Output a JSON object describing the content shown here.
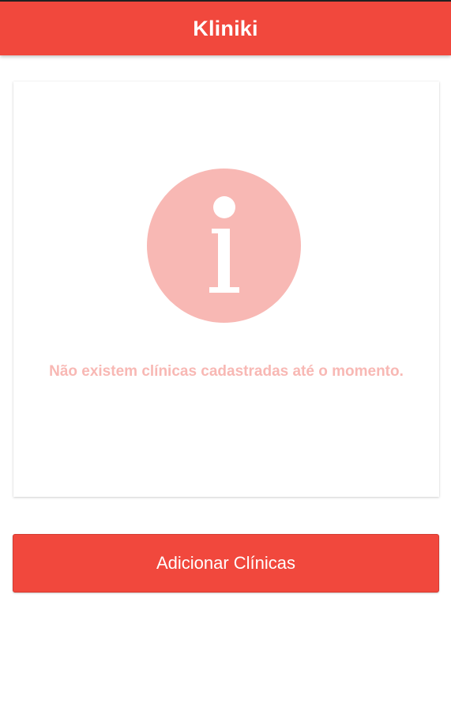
{
  "app_bar": {
    "title": "Kliniki"
  },
  "empty_state": {
    "icon": "info-icon",
    "message": "Não existem clínicas cadastradas até o momento."
  },
  "actions": {
    "add_button_label": "Adicionar Clínicas"
  },
  "colors": {
    "primary": "#f1483d",
    "empty_state_tint": "#f8b8b4",
    "background": "#ffffff"
  }
}
